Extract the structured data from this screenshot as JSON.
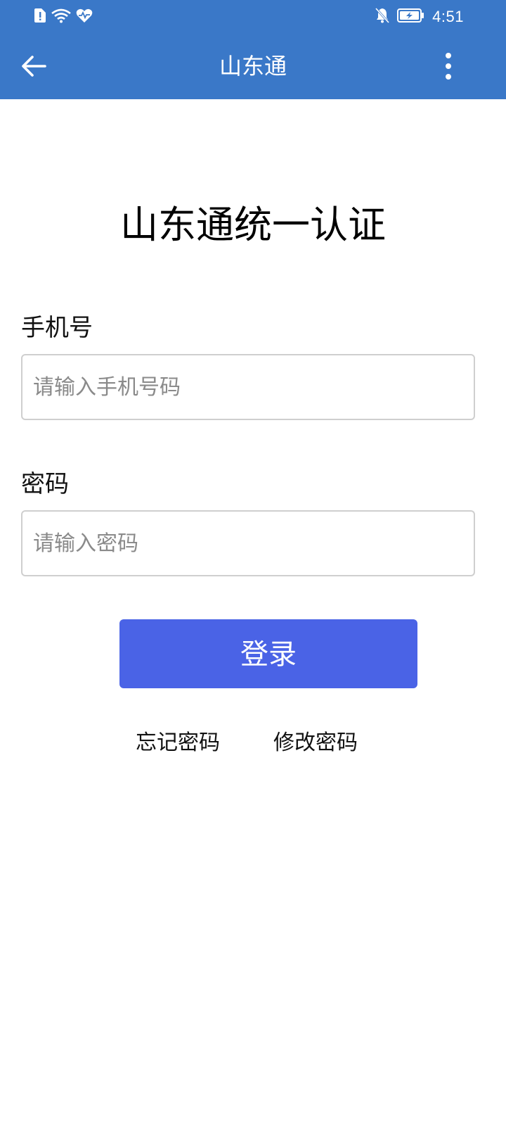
{
  "status_bar": {
    "time": "4:51",
    "icons": [
      "sim-alert-icon",
      "wifi-icon",
      "heart-monitor-icon",
      "notifications-off-icon",
      "battery-charging-icon"
    ]
  },
  "app_bar": {
    "title": "山东通",
    "back_icon": "arrow-left-icon",
    "more_icon": "more-vertical-icon"
  },
  "page": {
    "title": "山东通统一认证",
    "phone": {
      "label": "手机号",
      "placeholder": "请输入手机号码",
      "value": ""
    },
    "password": {
      "label": "密码",
      "placeholder": "请输入密码",
      "value": ""
    },
    "login_button": "登录",
    "forgot_password": "忘记密码",
    "change_password": "修改密码"
  },
  "colors": {
    "primary": "#3A78C8",
    "button": "#4A63E6",
    "input_border": "#cfcfcf",
    "background": "#ffffff"
  }
}
